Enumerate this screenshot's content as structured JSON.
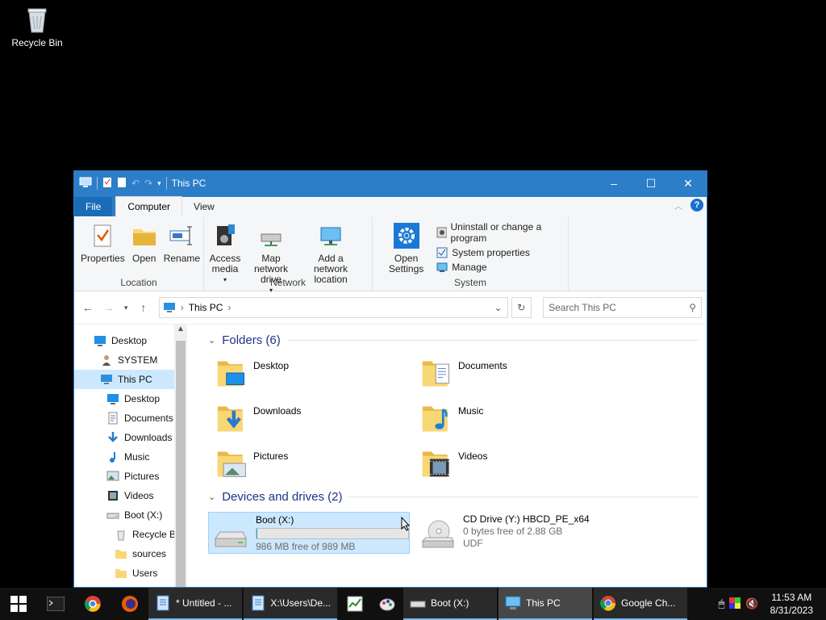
{
  "desktop": {
    "recycle_bin": "Recycle Bin"
  },
  "window": {
    "title": "This PC",
    "tabs": {
      "file": "File",
      "computer": "Computer",
      "view": "View"
    },
    "ribbon": {
      "location": {
        "label": "Location",
        "properties": "Properties",
        "open": "Open",
        "rename": "Rename"
      },
      "network": {
        "label": "Network",
        "access_media": "Access media",
        "map_drive": "Map network drive",
        "add_location": "Add a network location"
      },
      "system": {
        "label": "System",
        "open_settings": "Open Settings",
        "uninstall": "Uninstall or change a program",
        "system_properties": "System properties",
        "manage": "Manage"
      }
    },
    "address": {
      "path": "This PC",
      "search_placeholder": "Search This PC"
    },
    "nav": [
      {
        "label": "Desktop",
        "level": 0,
        "icon": "desktop-icon"
      },
      {
        "label": "SYSTEM",
        "level": 1,
        "icon": "user-icon"
      },
      {
        "label": "This PC",
        "level": 1,
        "icon": "pc-icon",
        "selected": true
      },
      {
        "label": "Desktop",
        "level": 2,
        "icon": "desktop-icon"
      },
      {
        "label": "Documents",
        "level": 2,
        "icon": "documents-icon"
      },
      {
        "label": "Downloads",
        "level": 2,
        "icon": "downloads-icon"
      },
      {
        "label": "Music",
        "level": 2,
        "icon": "music-icon"
      },
      {
        "label": "Pictures",
        "level": 2,
        "icon": "pictures-icon"
      },
      {
        "label": "Videos",
        "level": 2,
        "icon": "videos-icon"
      },
      {
        "label": "Boot (X:)",
        "level": 2,
        "icon": "drive-icon"
      },
      {
        "label": "Recycle Bin",
        "level": 3,
        "icon": "recycle-bin-icon"
      },
      {
        "label": "sources",
        "level": 3,
        "icon": "folder-icon"
      },
      {
        "label": "Users",
        "level": 3,
        "icon": "folder-icon"
      }
    ],
    "folders_header": "Folders (6)",
    "folders": [
      {
        "name": "Desktop",
        "icon": "desktop-folder-icon"
      },
      {
        "name": "Documents",
        "icon": "documents-folder-icon"
      },
      {
        "name": "Downloads",
        "icon": "downloads-folder-icon"
      },
      {
        "name": "Music",
        "icon": "music-folder-icon"
      },
      {
        "name": "Pictures",
        "icon": "pictures-folder-icon"
      },
      {
        "name": "Videos",
        "icon": "videos-folder-icon"
      }
    ],
    "drives_header": "Devices and drives (2)",
    "drives": [
      {
        "name": "Boot (X:)",
        "free": "986 MB free of 989 MB",
        "used_fraction": 0.003,
        "selected": true
      },
      {
        "name": "CD Drive (Y:) HBCD_PE_x64",
        "free": "0 bytes free of 2.88 GB",
        "fs": "UDF"
      }
    ]
  },
  "taskbar": {
    "items": [
      {
        "label": "* Untitled - ...",
        "icon": "notepad-icon"
      },
      {
        "label": "X:\\Users\\De...",
        "icon": "notepad-icon"
      },
      {
        "label": "Boot (X:)",
        "icon": "drive-icon"
      },
      {
        "label": "This PC",
        "icon": "pc-icon",
        "active": true
      },
      {
        "label": "Google Ch...",
        "icon": "chrome-icon"
      }
    ],
    "time": "11:53 AM",
    "date": "8/31/2023"
  }
}
